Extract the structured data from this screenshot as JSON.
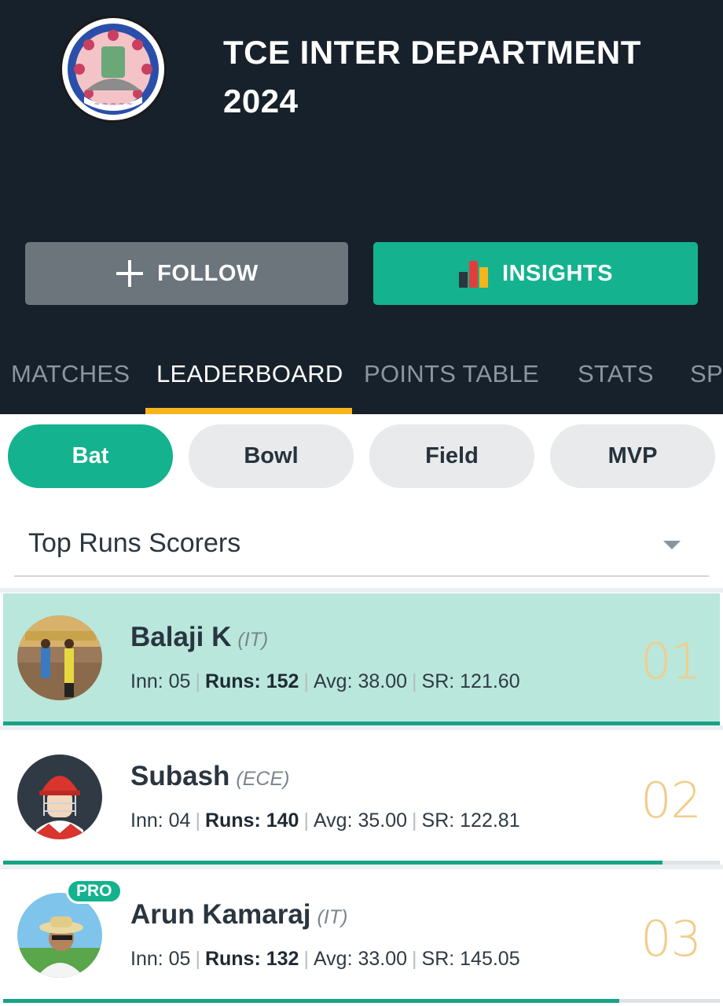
{
  "header": {
    "title_line1": "TCE INTER DEPARTMENT",
    "title_line2": "2024",
    "follow_label": "FOLLOW",
    "insights_label": "INSIGHTS"
  },
  "tabs": [
    "MATCHES",
    "LEADERBOARD",
    "POINTS TABLE",
    "STATS",
    "SP"
  ],
  "active_tab": "LEADERBOARD",
  "filters": [
    "Bat",
    "Bowl",
    "Field",
    "MVP"
  ],
  "active_filter": "Bat",
  "dropdown": {
    "selected": "Top Runs Scorers"
  },
  "players": [
    {
      "name": "Balaji K",
      "dept": "(IT)",
      "inn_label": "Inn: 05",
      "runs_label": "Runs: 152",
      "avg_label": "Avg: 38.00",
      "sr_label": "SR: 121.60",
      "rank": "01",
      "progress": 1.0
    },
    {
      "name": "Subash",
      "dept": "(ECE)",
      "inn_label": "Inn: 04",
      "runs_label": "Runs: 140",
      "avg_label": "Avg: 35.00",
      "sr_label": "SR: 122.81",
      "rank": "02",
      "progress": 0.92
    },
    {
      "name": "Arun Kamaraj",
      "dept": "(IT)",
      "inn_label": "Inn: 05",
      "runs_label": "Runs: 132",
      "avg_label": "Avg: 33.00",
      "sr_label": "SR: 145.05",
      "rank": "03",
      "progress": 0.86,
      "badge": "PRO"
    }
  ],
  "colors": {
    "header_bg": "#17212b",
    "accent": "#14b28f",
    "tab_underline": "#f7b51d",
    "rank": "#f1cd8a",
    "highlight": "#b9e7dc"
  }
}
